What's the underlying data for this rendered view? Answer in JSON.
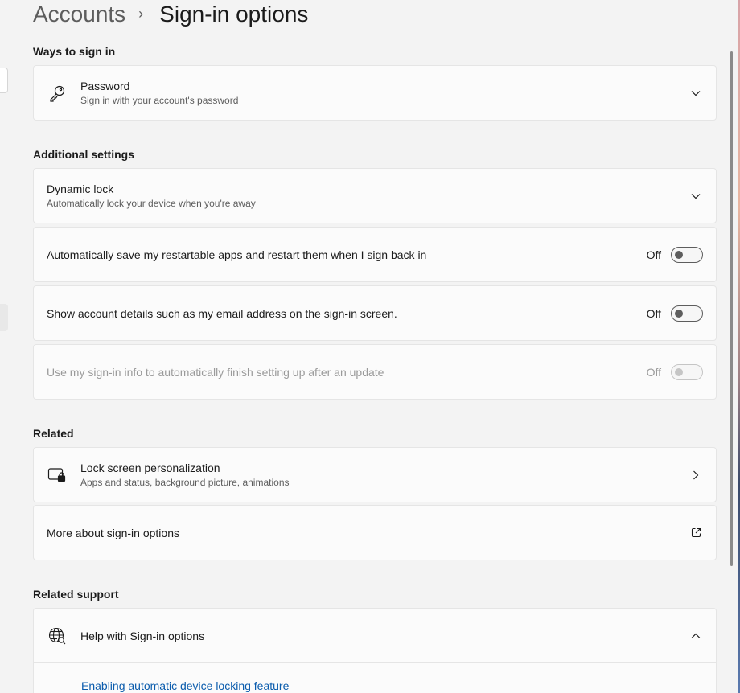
{
  "breadcrumb": {
    "parent": "Accounts",
    "separator": "›",
    "current": "Sign-in options"
  },
  "ways_to_sign_in": {
    "heading": "Ways to sign in",
    "password": {
      "title": "Password",
      "subtitle": "Sign in with your account's password",
      "icon": "key-icon"
    }
  },
  "additional_settings": {
    "heading": "Additional settings",
    "dynamic_lock": {
      "title": "Dynamic lock",
      "subtitle": "Automatically lock your device when you're away"
    },
    "restart_apps": {
      "title": "Automatically save my restartable apps and restart them when I sign back in",
      "state": "Off"
    },
    "account_details": {
      "title": "Show account details such as my email address on the sign-in screen.",
      "state": "Off"
    },
    "signin_info": {
      "title": "Use my sign-in info to automatically finish setting up after an update",
      "state": "Off"
    }
  },
  "related": {
    "heading": "Related",
    "lock_screen": {
      "title": "Lock screen personalization",
      "subtitle": "Apps and status, background picture, animations",
      "icon": "lock-screen-icon"
    },
    "more_about": {
      "title": "More about sign-in options",
      "icon": "open-external-icon"
    }
  },
  "related_support": {
    "heading": "Related support",
    "help": {
      "title": "Help with Sign-in options",
      "icon": "globe-help-icon"
    },
    "link": "Enabling automatic device locking feature"
  },
  "colors": {
    "background": "#f3f3f3",
    "card": "#fbfbfb",
    "link": "#0b5cad"
  }
}
